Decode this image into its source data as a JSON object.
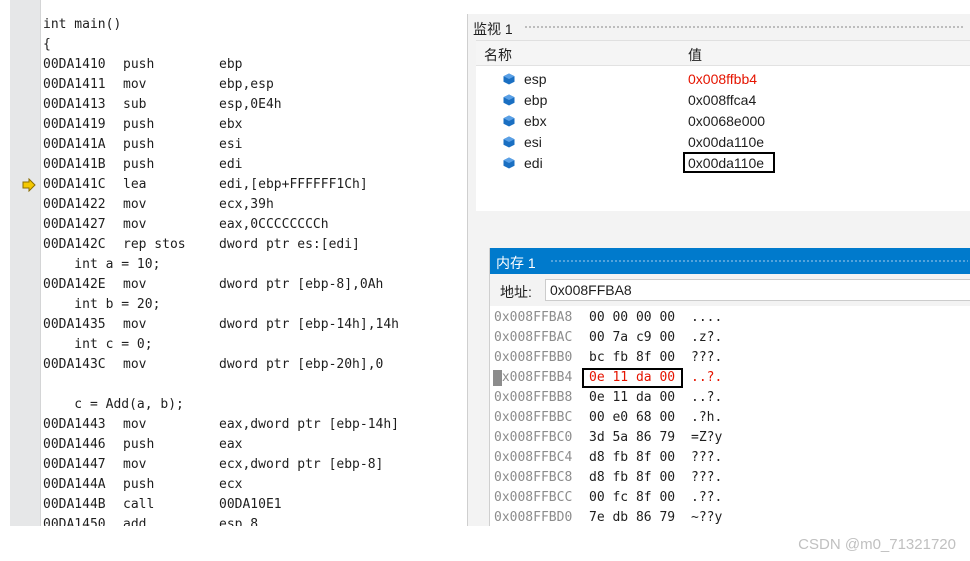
{
  "disassembly": {
    "lines": [
      {
        "kind": "src",
        "text": "int main()"
      },
      {
        "kind": "src",
        "text": "{"
      },
      {
        "kind": "asm",
        "addr": "00DA1410",
        "mnemonic": "push",
        "operands": "ebp"
      },
      {
        "kind": "asm",
        "addr": "00DA1411",
        "mnemonic": "mov",
        "operands": "ebp,esp"
      },
      {
        "kind": "asm",
        "addr": "00DA1413",
        "mnemonic": "sub",
        "operands": "esp,0E4h"
      },
      {
        "kind": "asm",
        "addr": "00DA1419",
        "mnemonic": "push",
        "operands": "ebx"
      },
      {
        "kind": "asm",
        "addr": "00DA141A",
        "mnemonic": "push",
        "operands": "esi"
      },
      {
        "kind": "asm",
        "addr": "00DA141B",
        "mnemonic": "push",
        "operands": "edi"
      },
      {
        "kind": "asm",
        "addr": "00DA141C",
        "mnemonic": "lea",
        "operands": "edi,[ebp+FFFFFF1Ch]"
      },
      {
        "kind": "asm",
        "addr": "00DA1422",
        "mnemonic": "mov",
        "operands": "ecx,39h"
      },
      {
        "kind": "asm",
        "addr": "00DA1427",
        "mnemonic": "mov",
        "operands": "eax,0CCCCCCCCh"
      },
      {
        "kind": "asm",
        "addr": "00DA142C",
        "mnemonic": "rep stos",
        "operands": "dword ptr es:[edi]"
      },
      {
        "kind": "src",
        "text": "    int a = 10;"
      },
      {
        "kind": "asm",
        "addr": "00DA142E",
        "mnemonic": "mov",
        "operands": "dword ptr [ebp-8],0Ah"
      },
      {
        "kind": "src",
        "text": "    int b = 20;"
      },
      {
        "kind": "asm",
        "addr": "00DA1435",
        "mnemonic": "mov",
        "operands": "dword ptr [ebp-14h],14h"
      },
      {
        "kind": "src",
        "text": "    int c = 0;"
      },
      {
        "kind": "asm",
        "addr": "00DA143C",
        "mnemonic": "mov",
        "operands": "dword ptr [ebp-20h],0"
      },
      {
        "kind": "src",
        "text": ""
      },
      {
        "kind": "src",
        "text": "    c = Add(a, b);"
      },
      {
        "kind": "asm",
        "addr": "00DA1443",
        "mnemonic": "mov",
        "operands": "eax,dword ptr [ebp-14h]"
      },
      {
        "kind": "asm",
        "addr": "00DA1446",
        "mnemonic": "push",
        "operands": "eax"
      },
      {
        "kind": "asm",
        "addr": "00DA1447",
        "mnemonic": "mov",
        "operands": "ecx,dword ptr [ebp-8]"
      },
      {
        "kind": "asm",
        "addr": "00DA144A",
        "mnemonic": "push",
        "operands": "ecx"
      },
      {
        "kind": "asm",
        "addr": "00DA144B",
        "mnemonic": "call",
        "operands": "00DA10E1"
      },
      {
        "kind": "asm",
        "addr": "00DA1450",
        "mnemonic": "add",
        "operands": "esp,8"
      }
    ],
    "current_line_addr": "00DA141C",
    "arrow_color": "#f4c800"
  },
  "watch": {
    "title": "监视 1",
    "col_name": "名称",
    "col_value": "值",
    "rows": [
      {
        "name": "esp",
        "value": "0x008ffbb4",
        "changed": true
      },
      {
        "name": "ebp",
        "value": "0x008ffca4",
        "changed": false
      },
      {
        "name": "ebx",
        "value": "0x0068e000",
        "changed": false
      },
      {
        "name": "esi",
        "value": "0x00da110e",
        "changed": false
      },
      {
        "name": "edi",
        "value": "0x00da110e",
        "changed": false
      }
    ],
    "icon_color": "#1a6fc2"
  },
  "memory": {
    "title": "内存 1",
    "address_label": "地址:",
    "address_value": "0x008FFBA8",
    "rows": [
      {
        "addr": "0x008FFBA8",
        "bytes": "00 00 00 00",
        "ascii": "....",
        "changed": false
      },
      {
        "addr": "0x008FFBAC",
        "bytes": "00 7a c9 00",
        "ascii": ".z?.",
        "changed": false
      },
      {
        "addr": "0x008FFBB0",
        "bytes": "bc fb 8f 00",
        "ascii": "???.",
        "changed": false
      },
      {
        "addr": "0x008FFBB4",
        "bytes": "0e 11 da 00",
        "ascii": "..?.",
        "changed": true
      },
      {
        "addr": "0x008FFBB8",
        "bytes": "0e 11 da 00",
        "ascii": "..?.",
        "changed": false
      },
      {
        "addr": "0x008FFBBC",
        "bytes": "00 e0 68 00",
        "ascii": ".?h.",
        "changed": false
      },
      {
        "addr": "0x008FFBC0",
        "bytes": "3d 5a 86 79",
        "ascii": "=Z?y",
        "changed": false
      },
      {
        "addr": "0x008FFBC4",
        "bytes": "d8 fb 8f 00",
        "ascii": "???.",
        "changed": false
      },
      {
        "addr": "0x008FFBC8",
        "bytes": "d8 fb 8f 00",
        "ascii": "???.",
        "changed": false
      },
      {
        "addr": "0x008FFBCC",
        "bytes": "00 fc 8f 00",
        "ascii": ".??.",
        "changed": false
      },
      {
        "addr": "0x008FFBD0",
        "bytes": "7e db 86 79",
        "ascii": "~??y",
        "changed": false
      }
    ],
    "title_bar_color": "#007acc",
    "changed_color": "#e51400"
  },
  "watermark": "CSDN @m0_71321720"
}
